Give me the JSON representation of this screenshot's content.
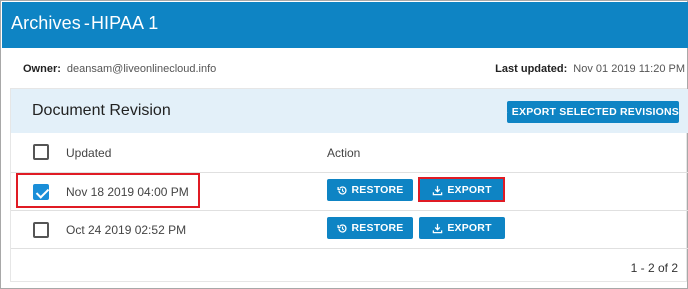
{
  "header": {
    "section": "Archives",
    "separator": "-",
    "name": "HIPAA 1"
  },
  "meta": {
    "owner_label": "Owner:",
    "owner_value": "deansam@liveonlinecloud.info",
    "updated_label": "Last updated:",
    "updated_value": "Nov 01 2019 11:20 PM"
  },
  "panel": {
    "title": "Document Revision",
    "export_selected_label": "EXPORT SELECTED REVISIONS"
  },
  "table": {
    "columns": {
      "updated": "Updated",
      "action": "Action"
    },
    "rows": [
      {
        "updated": "Nov 18 2019 04:00 PM",
        "checked": true,
        "restore_label": "RESTORE",
        "export_label": "EXPORT"
      },
      {
        "updated": "Oct 24 2019 02:52 PM",
        "checked": false,
        "restore_label": "RESTORE",
        "export_label": "EXPORT"
      }
    ]
  },
  "pagination": {
    "text": "1 - 2 of 2"
  },
  "colors": {
    "accent": "#0e84c4",
    "header_bg": "#0e84c4",
    "panel_head_bg": "#e3f0f9",
    "highlight": "#e01b24",
    "checkbox_checked": "#1a8ed8"
  },
  "icons": {
    "export": "download-tray-icon",
    "restore": "history-restore-icon"
  }
}
